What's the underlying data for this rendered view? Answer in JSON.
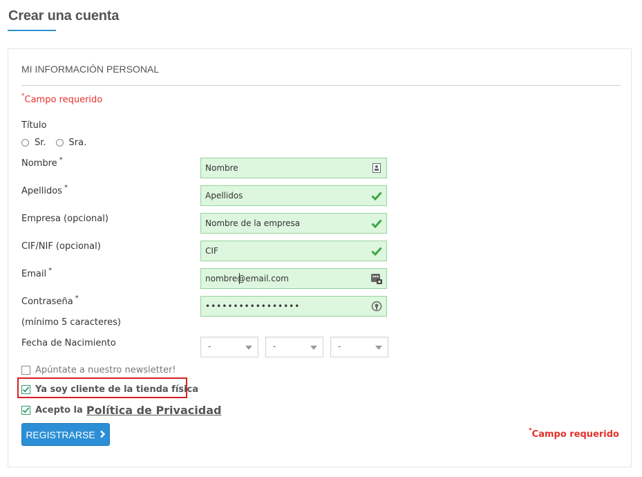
{
  "page": {
    "title": "Crear una cuenta",
    "accent_color": "#2c8fd6",
    "error_color": "#e4312b",
    "valid_color": "#3ea640"
  },
  "form": {
    "section_title": "MI INFORMACIÓN PERSONAL",
    "required_mark": "*",
    "required_text": "Campo requerido",
    "title_label": "Título",
    "title_options": [
      "Sr.",
      "Sra."
    ],
    "fields": {
      "nombre": {
        "label": "Nombre",
        "value": "Nombre",
        "icon": "contact-card-icon"
      },
      "apellidos": {
        "label": "Apellidos",
        "value": "Apellidos",
        "icon": "checkmark-icon"
      },
      "empresa": {
        "label": "Empresa (opcional)",
        "value": "Nombre de la empresa",
        "icon": "checkmark-icon"
      },
      "cif": {
        "label": "CIF/NIF (opcional)",
        "value": "CIF",
        "icon": "checkmark-icon"
      },
      "email": {
        "label": "Email",
        "value": "nombre@email.com",
        "icon": "autofill-icon"
      },
      "password": {
        "label": "Contraseña",
        "value": "•••••••••••••••••",
        "hint": "(mínimo 5 caracteres)",
        "icon": "password-manager-icon"
      }
    },
    "birthdate": {
      "label": "Fecha de Nacimiento",
      "day": "-",
      "month": "-",
      "year": "-"
    },
    "checkboxes": {
      "newsletter": {
        "label": "Apúntate a nuestro newsletter!",
        "checked": false
      },
      "store_client": {
        "label": "Ya soy cliente de la tienda física",
        "checked": true
      },
      "privacy": {
        "label_prefix": "Acepto la",
        "link_text": "Política de Privacidad",
        "checked": true
      }
    },
    "submit_label": "REGISTRARSE"
  }
}
